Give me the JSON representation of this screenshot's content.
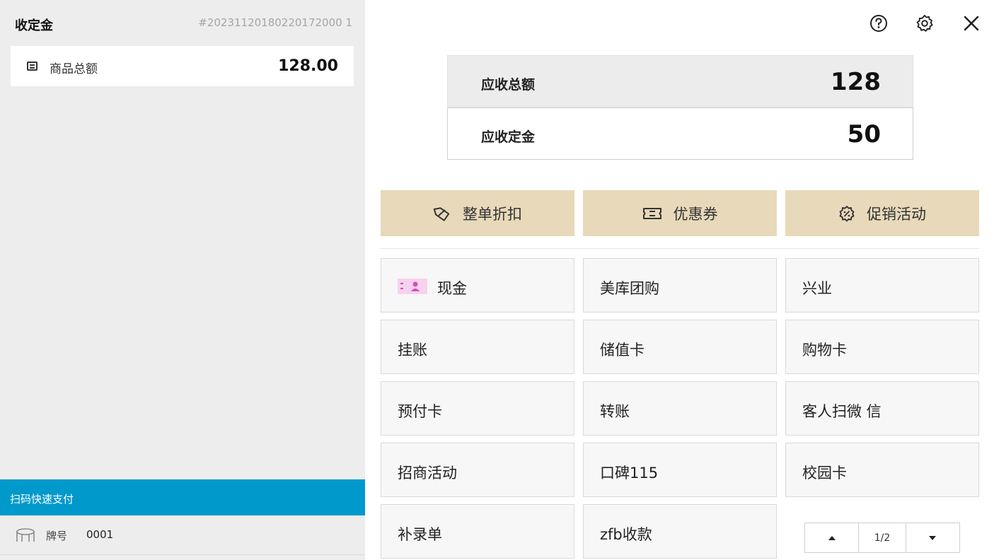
{
  "left": {
    "title": "收定金",
    "order_no": "#20231120180220172000 1",
    "summary": {
      "label": "商品总额",
      "value": "128.00"
    },
    "scan_pay": "扫码快速支付",
    "table": {
      "label": "牌号",
      "number": "0001"
    }
  },
  "top_icons": [
    "help-icon",
    "settings-icon",
    "close-icon"
  ],
  "amounts": {
    "total_label": "应收总额",
    "total_value": "128",
    "deposit_label": "应收定金",
    "deposit_value": "50"
  },
  "promos": [
    {
      "label": "整单折扣",
      "icon": "discount-icon"
    },
    {
      "label": "优惠券",
      "icon": "coupon-icon"
    },
    {
      "label": "促销活动",
      "icon": "promotion-icon"
    }
  ],
  "payments": [
    "现金",
    "美库团购",
    "兴业",
    "挂账",
    "储值卡",
    "购物卡",
    "预付卡",
    "转账",
    "客人扫微 信",
    "招商活动",
    "口碑115",
    "校园卡",
    "补录单",
    "zfb收款"
  ],
  "pager": {
    "page": "1/2"
  },
  "colors": {
    "scan_bar": "#0099cc",
    "promo_bg": "#e8d9ba",
    "cash_icon": "#f7d2ee"
  }
}
